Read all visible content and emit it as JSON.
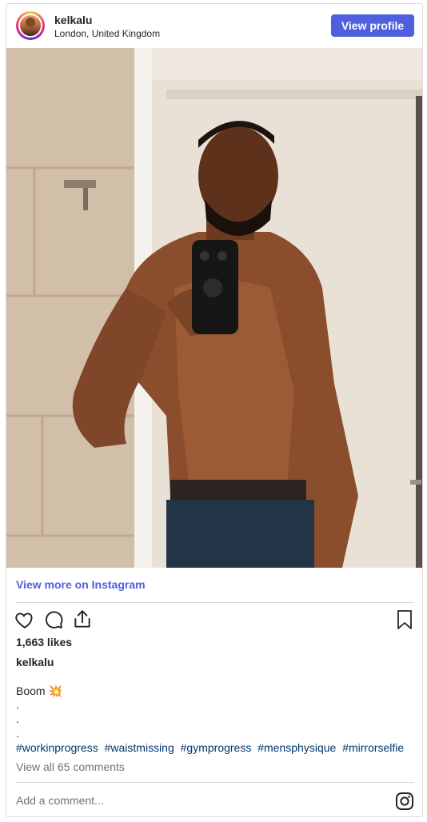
{
  "header": {
    "username": "kelkalu",
    "location": "London, United Kingdom",
    "view_profile_label": "View profile"
  },
  "post": {
    "view_more_label": "View more on Instagram",
    "likes_text": "1,663 likes",
    "caption_username": "kelkalu",
    "caption_text": "Boom 💥",
    "caption_dots": [
      ".",
      ".",
      "."
    ],
    "hashtags": [
      "#workinprogress",
      "#waistmissing",
      "#gymprogress",
      "#mensphysique",
      "#mirrorselfie"
    ],
    "view_comments_label": "View all 65 comments",
    "add_comment_placeholder": "Add a comment..."
  },
  "icons": {
    "like": "heart-icon",
    "comment": "comment-icon",
    "share": "share-icon",
    "save": "bookmark-icon",
    "instagram": "instagram-icon"
  },
  "colors": {
    "accent": "#4f5fde",
    "hashtag": "#00376b",
    "muted": "#737373",
    "border": "#dbdbdb"
  }
}
